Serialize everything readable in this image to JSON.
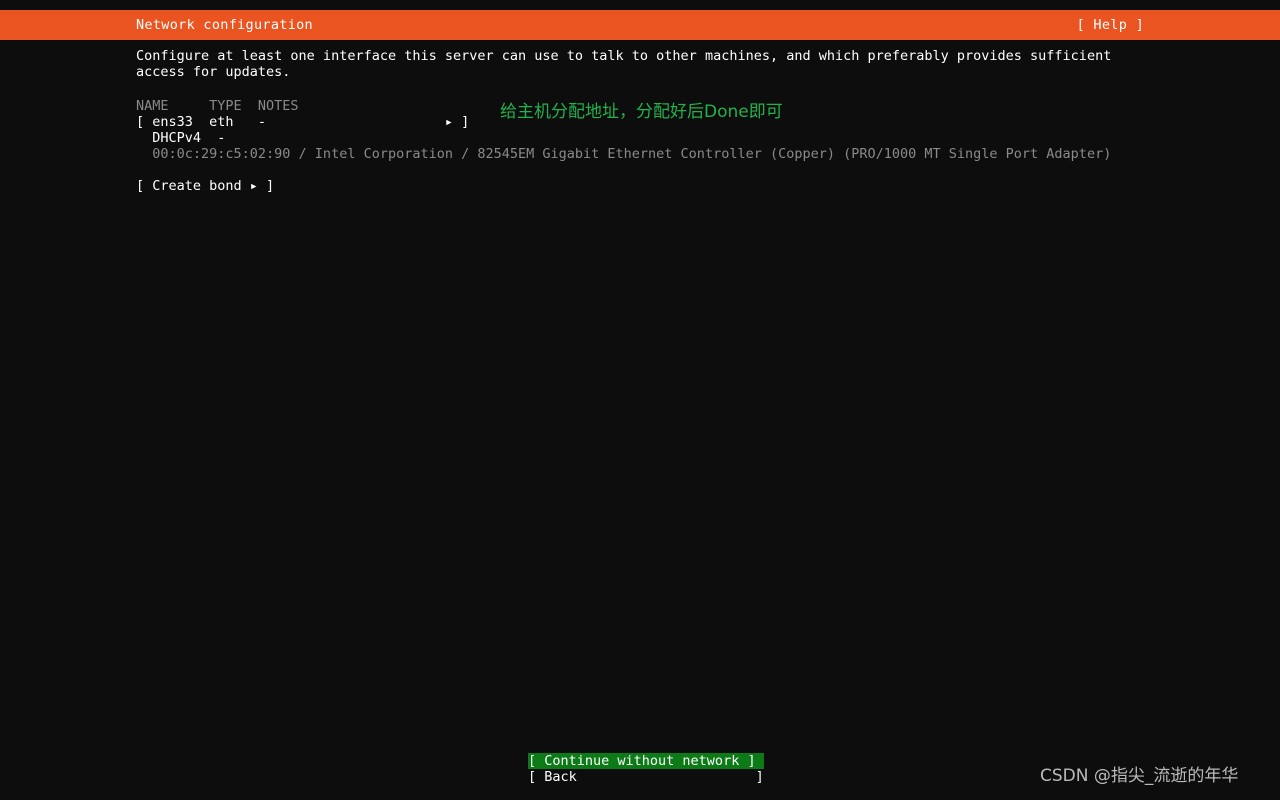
{
  "colors": {
    "background": "#0d0d0d",
    "header_bar": "#e95420",
    "header_text": "#ffffff",
    "dim_text": "#8a8a8a",
    "selection_green": "#0c7a16",
    "annotation_green": "#22b14c",
    "watermark": "#c9c9c9"
  },
  "header": {
    "title": "Network configuration",
    "help_label": "[ Help ]"
  },
  "main": {
    "intro_line1": "Configure at least one interface this server can use to talk to other machines, and which preferably provides sufficient",
    "intro_line2": "access for updates.",
    "table": {
      "headers_line": "NAME     TYPE  NOTES",
      "header_name": "NAME",
      "header_type": "TYPE",
      "header_notes": "NOTES"
    },
    "interfaces": [
      {
        "bracket_open": "[",
        "name": "ens33",
        "type": "eth",
        "notes": "-",
        "arrow_icon": "right-triangle-icon",
        "bracket_close": "]",
        "row_text": "[ ens33  eth   -                      ▸ ]",
        "sub_row_text": "  DHCPv4  -",
        "sub_proto": "DHCPv4",
        "sub_value": "-",
        "detail_text": "  00:0c:29:c5:02:90 / Intel Corporation / 82545EM Gigabit Ethernet Controller (Copper) (PRO/1000 MT Single Port Adapter)"
      }
    ],
    "create_bond_label": "[ Create bond ▸ ]",
    "annotation_text": "给主机分配地址，分配好后Done即可"
  },
  "footer": {
    "buttons": [
      {
        "label": "[ Continue without network ]",
        "selected": true
      },
      {
        "label": "[ Back                      ]",
        "selected": false
      }
    ],
    "watermark": "CSDN @指尖_流逝的年华"
  }
}
